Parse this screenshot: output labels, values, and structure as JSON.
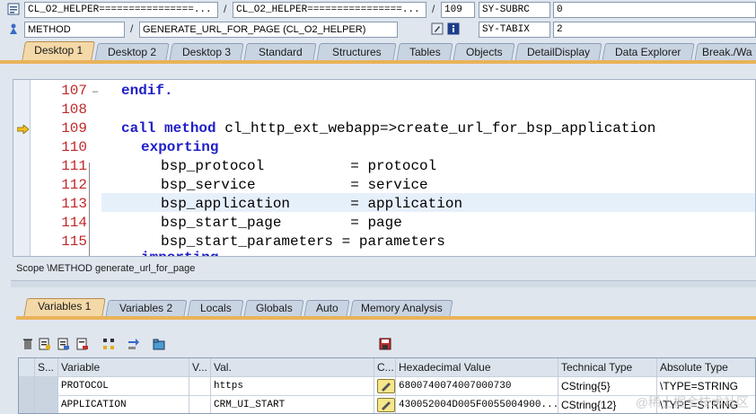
{
  "header": {
    "row1": {
      "field1": "CL_O2_HELPER================...",
      "field2": "CL_O2_HELPER================...",
      "line": "109",
      "sysvar": "SY-SUBRC",
      "sysval": "0"
    },
    "row2": {
      "field1": "METHOD",
      "field2": "GENERATE_URL_FOR_PAGE (CL_O2_HELPER)",
      "sysvar": "SY-TABIX",
      "sysval": "2"
    },
    "sep": "/"
  },
  "desktop_tabs": [
    "Desktop 1",
    "Desktop 2",
    "Desktop 3",
    "Standard",
    "Structures",
    "Tables",
    "Objects",
    "DetailDisplay",
    "Data Explorer",
    "Break./Wa"
  ],
  "editor": {
    "line_numbers": [
      "107",
      "108",
      "109",
      "110",
      "111",
      "112",
      "113",
      "114",
      "115"
    ],
    "lines": {
      "l107_kw": "endif.",
      "l109_kw1": "call method",
      "l109_rest": " cl_http_ext_webapp=>create_url_for_bsp_application",
      "l110_kw": "exporting",
      "l111": "bsp_protocol          = protocol",
      "l112": "bsp_service           = service",
      "l113": "bsp_application       = application",
      "l114": "bsp_start_page        = page",
      "l115": "bsp_start_parameters = parameters",
      "l116_kw": "importing"
    },
    "current_line": "109"
  },
  "scope": "Scope \\METHOD generate_url_for_page",
  "var_tabs": [
    "Variables 1",
    "Variables 2",
    "Locals",
    "Globals",
    "Auto",
    "Memory Analysis"
  ],
  "table": {
    "headers": [
      "S...",
      "Variable",
      "V...",
      "Val.",
      "C...",
      "Hexadecimal Value",
      "Technical Type",
      "Absolute Type"
    ],
    "rows": [
      {
        "variable": "PROTOCOL",
        "value": "https",
        "hex": "6800740074007000730",
        "tech": "CString{5}",
        "abs": "\\TYPE=STRING"
      },
      {
        "variable": "APPLICATION",
        "value": "CRM_UI_START",
        "hex": "430052004D005F0055004900...",
        "tech": "CString{12}",
        "abs": "\\TYPE=STRING"
      }
    ]
  },
  "watermark": "@稀土掘金技术社区",
  "colors": {
    "accent": "#e9b35a",
    "keyword": "#1f1fc8",
    "line_number": "#c0282a"
  }
}
